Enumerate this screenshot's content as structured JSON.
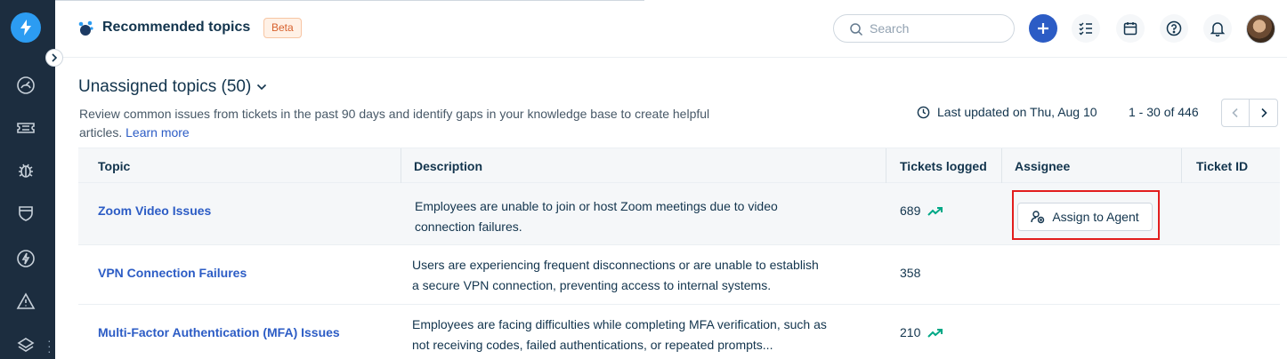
{
  "sidebar": {
    "logo_icon": "lightning-bolt-logo",
    "items": [
      {
        "name": "dashboard-icon"
      },
      {
        "name": "tickets-icon"
      },
      {
        "name": "bug-icon"
      },
      {
        "name": "shield-icon"
      },
      {
        "name": "bolt-circle-icon"
      },
      {
        "name": "warning-icon"
      },
      {
        "name": "layers-icon"
      }
    ]
  },
  "header": {
    "title": "Recommended topics",
    "badge": "Beta",
    "search_placeholder": "Search"
  },
  "section": {
    "title": "Unassigned topics (50)",
    "description": "Review common issues from tickets in the past 90 days and identify gaps in your knowledge base to create helpful articles.",
    "learn_more": "Learn more",
    "last_updated": "Last updated on Thu, Aug 10",
    "range": "1 - 30 of 446"
  },
  "table": {
    "columns": [
      "Topic",
      "Description",
      "Tickets logged",
      "Assignee",
      "Ticket ID"
    ],
    "rows": [
      {
        "topic": "Zoom Video Issues",
        "description_line1": "Employees are unable to join or host Zoom meetings due to video",
        "description_line2": "connection failures.",
        "tickets": "689",
        "trend": "up",
        "assignee_action": "Assign to Agent"
      },
      {
        "topic": "VPN Connection Failures",
        "description_line1": "Users are experiencing frequent disconnections or are unable to establish",
        "description_line2": "a secure VPN connection, preventing access to internal systems.",
        "tickets": "358"
      },
      {
        "topic": "Multi-Factor Authentication (MFA) Issues",
        "description_line1": "Employees are facing difficulties while completing MFA verification, such as",
        "description_line2": "not receiving codes, failed authentications, or repeated prompts...",
        "tickets": "210",
        "trend": "up"
      }
    ]
  },
  "colors": {
    "sidebar_bg": "#1c2d3f",
    "accent": "#2c5cc5",
    "trend_up": "#00a886",
    "highlight": "#e21d1d"
  }
}
